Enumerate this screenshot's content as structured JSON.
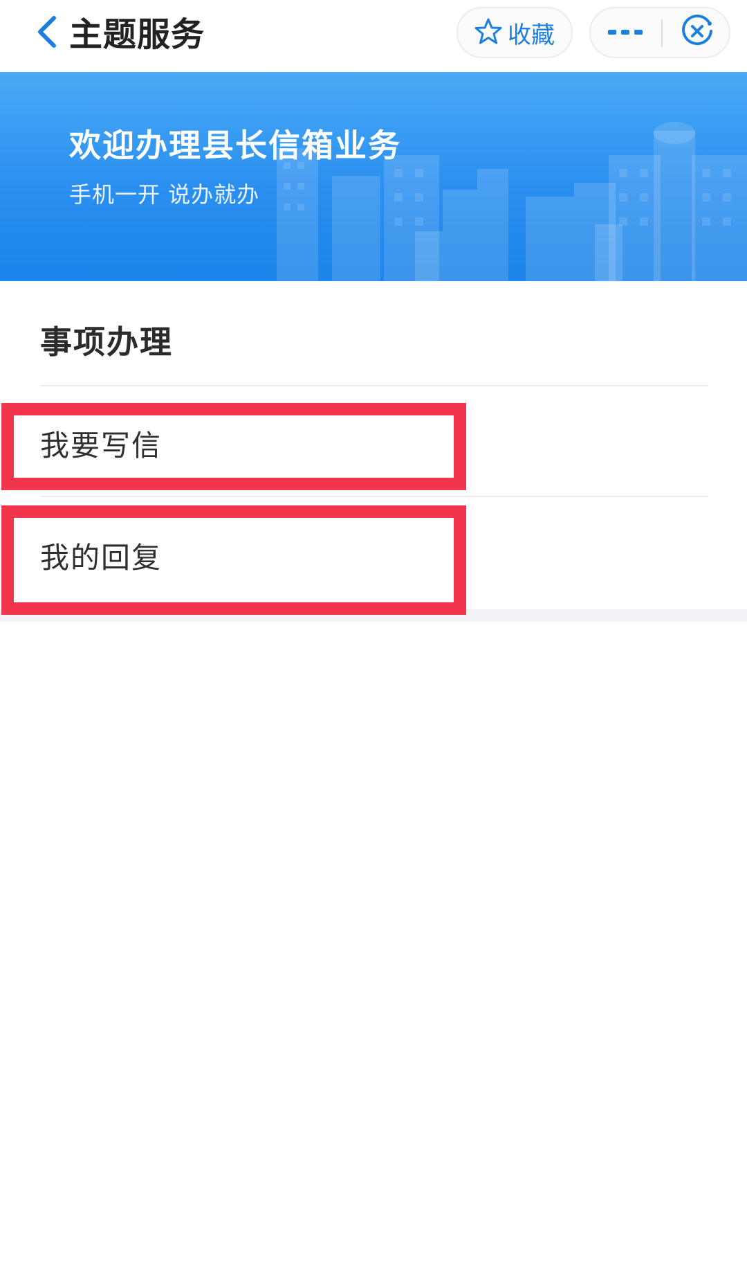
{
  "nav": {
    "title": "主题服务",
    "favorite_label": "收藏"
  },
  "banner": {
    "title": "欢迎办理县长信箱业务",
    "subtitle": "手机一开 说办就办"
  },
  "section": {
    "title": "事项办理",
    "items": [
      {
        "label": "我要写信"
      },
      {
        "label": "我的回复"
      }
    ]
  },
  "icons": {
    "back": "chevron-left-icon",
    "favorite": "star-icon",
    "more": "more-dots-icon",
    "close": "close-circle-icon"
  },
  "colors": {
    "accent": "#1b7fe0",
    "banner_top": "#4aaaf6",
    "banner_bottom": "#1c84ea",
    "highlight": "#f2354d"
  }
}
